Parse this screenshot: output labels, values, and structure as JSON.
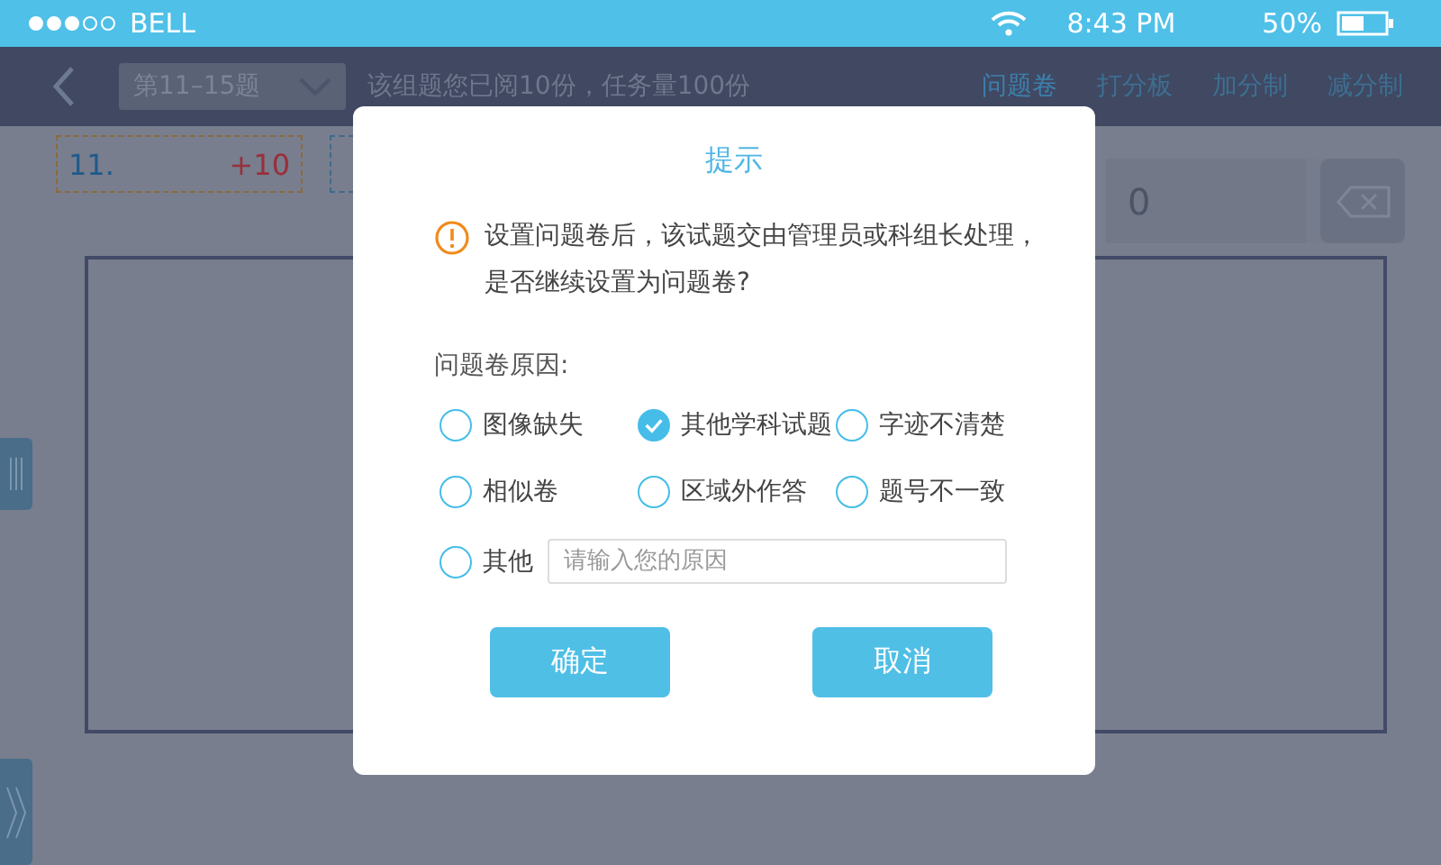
{
  "status_bar": {
    "carrier": "BELL",
    "time": "8:43 PM",
    "battery": "50%"
  },
  "nav": {
    "group_select": "第11–15题",
    "info": "该组题您已阅10份，任务量100份",
    "tabs": [
      {
        "label": "问题卷",
        "selected": true
      },
      {
        "label": "打分板",
        "selected": false
      },
      {
        "label": "加分制",
        "selected": false
      },
      {
        "label": "减分制",
        "selected": false
      }
    ]
  },
  "score_box": {
    "number": "11.",
    "score": "+10"
  },
  "score_input": {
    "value": "0"
  },
  "dialog": {
    "title": "提示",
    "message": "设置问题卷后，该试题交由管理员或科组长处理，是否继续设置为问题卷?",
    "reason_label": "问题卷原因:",
    "reasons": [
      {
        "label": "图像缺失",
        "selected": false
      },
      {
        "label": "其他学科试题",
        "selected": true
      },
      {
        "label": "字迹不清楚",
        "selected": false
      },
      {
        "label": "相似卷",
        "selected": false
      },
      {
        "label": "区域外作答",
        "selected": false
      },
      {
        "label": "题号不一致",
        "selected": false
      }
    ],
    "other": {
      "label": "其他",
      "selected": false,
      "placeholder": "请输入您的原因"
    },
    "buttons": [
      "确定",
      "取消"
    ]
  }
}
